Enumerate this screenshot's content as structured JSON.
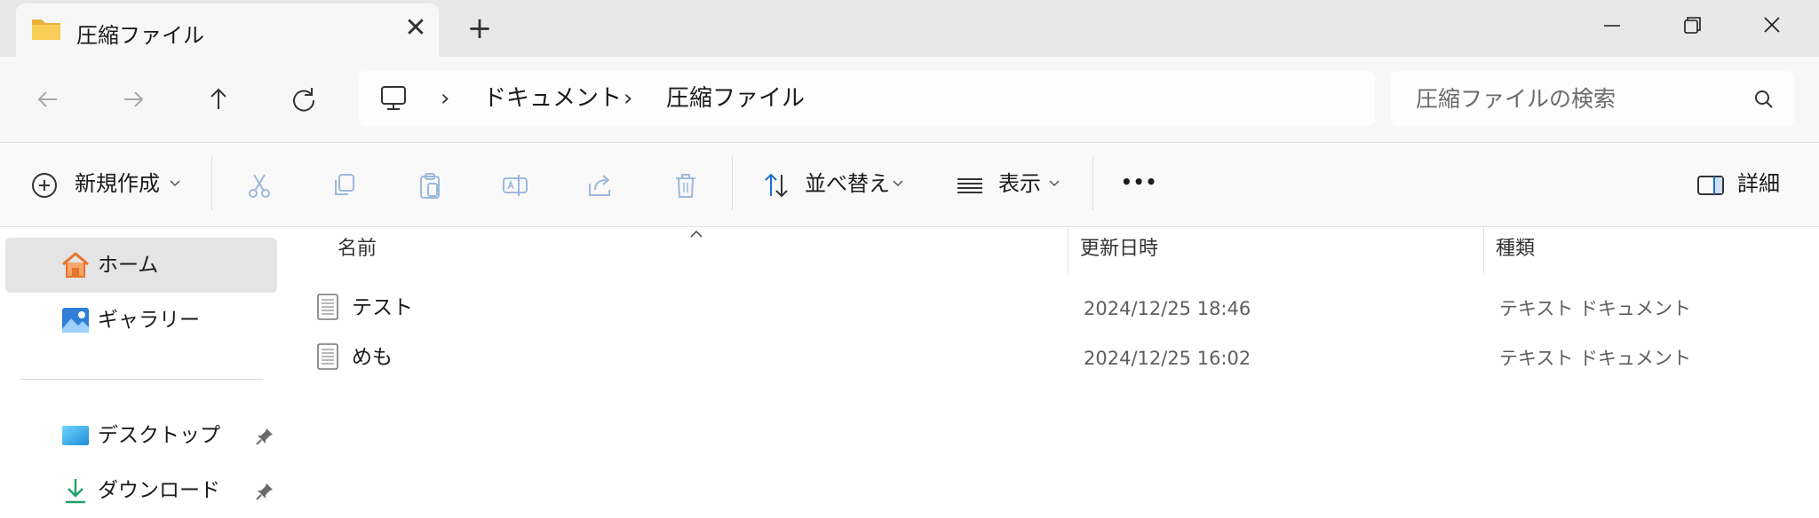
{
  "tab": {
    "title": "圧縮ファイル",
    "close_glyph": "✕",
    "new_tab_glyph": "+"
  },
  "address": {
    "breadcrumbs": [
      "ドキュメント",
      "圧縮ファイル"
    ],
    "separator": "›"
  },
  "search": {
    "placeholder": "圧縮ファイルの検索",
    "value": ""
  },
  "commands": {
    "new_label": "新規作成",
    "sort_label": "並べ替え",
    "view_label": "表示",
    "more_glyph": "•••",
    "details_label": "詳細"
  },
  "sidebar": {
    "items": [
      {
        "label": "ホーム",
        "icon": "home-icon"
      },
      {
        "label": "ギャラリー",
        "icon": "gallery-icon"
      },
      {
        "label": "デスクトップ",
        "icon": "desktop-icon",
        "pinned": true
      },
      {
        "label": "ダウンロード",
        "icon": "download-icon",
        "pinned": true
      }
    ]
  },
  "columns": {
    "name": "名前",
    "modified": "更新日時",
    "type": "種類"
  },
  "files": [
    {
      "name": "テスト",
      "modified": "2024/12/25 18:46",
      "type": "テキスト ドキュメント"
    },
    {
      "name": "めも",
      "modified": "2024/12/25 16:02",
      "type": "テキスト ドキュメント"
    }
  ],
  "colors": {
    "folder": "#f2c14e",
    "home_orange": "#e8732c",
    "accent_blue": "#1a6fd1",
    "selected_bg": "#e4e4e4"
  }
}
